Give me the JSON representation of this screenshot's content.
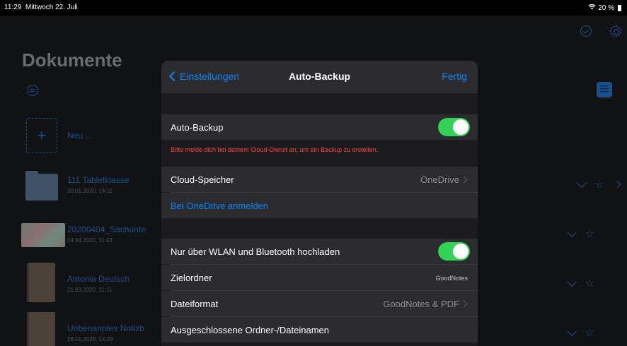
{
  "status": {
    "time": "11:29",
    "date": "Mittwoch 22. Juli",
    "wifi": "wifi-icon",
    "battery": "20 %"
  },
  "library": {
    "title": "Dokumente",
    "new_label": "Neu ...",
    "new_plus": "+",
    "documents": [
      {
        "name": "111 Tabletklasse",
        "date": "30.01.2020, 14:11"
      },
      {
        "name": "20200404_Sachunte",
        "date": "04.04.2020, 11:43"
      },
      {
        "name": "Antonia Deutsch",
        "date": "21.03.2020, 11:11"
      },
      {
        "name": "Unbenanntes Notizb",
        "date": "28.01.2020, 14:29"
      }
    ],
    "star_glyph": "☆"
  },
  "modal": {
    "back_label": "Einstellungen",
    "title": "Auto-Backup",
    "done_label": "Fertig",
    "auto_backup_label": "Auto-Backup",
    "auto_backup_on": true,
    "warning": "Bitte melde dich bei deinem Cloud-Dienst an, um ein Backup zu erstellen.",
    "cloud_label": "Cloud-Speicher",
    "cloud_value": "OneDrive",
    "signin_label": "Bei OneDrive anmelden",
    "wlan_label": "Nur über WLAN und Bluetooth hochladen",
    "wlan_on": true,
    "target_label": "Zielordner",
    "target_value": "GoodNotes",
    "format_label": "Dateiformat",
    "format_value": "GoodNotes & PDF",
    "excluded_label": "Ausgeschlossene Ordner-/Dateinamen"
  },
  "colors": {
    "accent": "#0a84ff",
    "toggle_on": "#32d158",
    "warning": "#ff453a"
  }
}
